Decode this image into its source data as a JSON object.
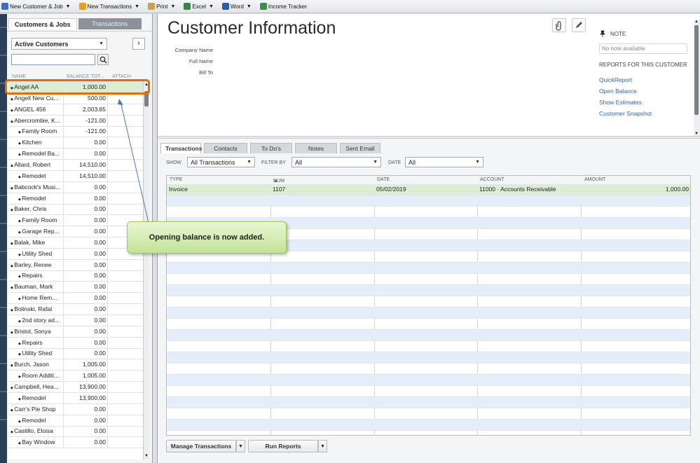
{
  "toolbar": {
    "items": [
      {
        "label": "New Customer & Job",
        "has_menu": true,
        "icon": "new-customer-icon",
        "color": "#3b6fb6"
      },
      {
        "label": "New Transactions",
        "has_menu": true,
        "icon": "new-transaction-icon",
        "color": "#e0a020"
      },
      {
        "label": "Print",
        "has_menu": true,
        "icon": "print-icon",
        "color": "#c9a24a"
      },
      {
        "label": "Excel",
        "has_menu": true,
        "icon": "excel-icon",
        "color": "#2d8a3e"
      },
      {
        "label": "Word",
        "has_menu": true,
        "icon": "word-icon",
        "color": "#2a5ca8"
      },
      {
        "label": "Income Tracker",
        "has_menu": false,
        "icon": "income-tracker-icon",
        "color": "#3c8f4a"
      }
    ]
  },
  "center": {
    "tabs": [
      {
        "label": "Customers & Jobs",
        "active": true
      },
      {
        "label": "Transactions",
        "active": false
      }
    ],
    "view_filter": "Active Customers",
    "search_value": "",
    "columns": [
      "NAME",
      "BALANCE TOT...",
      "ATTACH"
    ],
    "rows": [
      {
        "name": "Angel AA",
        "balance": "1,000.00",
        "sub": false,
        "selected": true
      },
      {
        "name": "Angell New Cu...",
        "balance": "500.00",
        "sub": false
      },
      {
        "name": "ANGEL 456",
        "balance": "2,003.65",
        "sub": false
      },
      {
        "name": "Abercrombie, K...",
        "balance": "-121.00",
        "sub": false
      },
      {
        "name": "Family Room",
        "balance": "-121.00",
        "sub": true
      },
      {
        "name": "Kitchen",
        "balance": "0.00",
        "sub": true
      },
      {
        "name": "Remodel Ba...",
        "balance": "0.00",
        "sub": true
      },
      {
        "name": "Allard, Robert",
        "balance": "14,510.00",
        "sub": false
      },
      {
        "name": "Remodel",
        "balance": "14,510.00",
        "sub": true
      },
      {
        "name": "Babcock's Musi...",
        "balance": "0.00",
        "sub": false
      },
      {
        "name": "Remodel",
        "balance": "0.00",
        "sub": true
      },
      {
        "name": "Baker, Chris",
        "balance": "0.00",
        "sub": false
      },
      {
        "name": "Family Room",
        "balance": "0.00",
        "sub": true
      },
      {
        "name": "Garage Rep...",
        "balance": "0.00",
        "sub": true
      },
      {
        "name": "Balak, Mike",
        "balance": "0.00",
        "sub": false
      },
      {
        "name": "Utility Shed",
        "balance": "0.00",
        "sub": true
      },
      {
        "name": "Barley, Renee",
        "balance": "0.00",
        "sub": false
      },
      {
        "name": "Repairs",
        "balance": "0.00",
        "sub": true
      },
      {
        "name": "Bauman, Mark",
        "balance": "0.00",
        "sub": false
      },
      {
        "name": "Home Rem...",
        "balance": "0.00",
        "sub": true
      },
      {
        "name": "Bolinski, Rafal",
        "balance": "0.00",
        "sub": false
      },
      {
        "name": "2nd story ad...",
        "balance": "0.00",
        "sub": true
      },
      {
        "name": "Bristol, Sonya",
        "balance": "0.00",
        "sub": false
      },
      {
        "name": "Repairs",
        "balance": "0.00",
        "sub": true
      },
      {
        "name": "Utility Shed",
        "balance": "0.00",
        "sub": true
      },
      {
        "name": "Burch, Jason",
        "balance": "1,005.00",
        "sub": false
      },
      {
        "name": "Room Additi...",
        "balance": "1,005.00",
        "sub": true
      },
      {
        "name": "Campbell, Hea...",
        "balance": "13,900.00",
        "sub": false
      },
      {
        "name": "Remodel",
        "balance": "13,900.00",
        "sub": true
      },
      {
        "name": "Carr's Pie Shop",
        "balance": "0.00",
        "sub": false
      },
      {
        "name": "Remodel",
        "balance": "0.00",
        "sub": true
      },
      {
        "name": "Castillo, Eloisa",
        "balance": "0.00",
        "sub": false
      },
      {
        "name": "Bay Window",
        "balance": "0.00",
        "sub": true
      }
    ]
  },
  "info": {
    "title": "Customer Information",
    "fields": [
      "Company Name",
      "Full Name",
      "Bill To"
    ],
    "note_label": "NOTE",
    "note_text": "No note available",
    "reports_label": "REPORTS FOR THIS CUSTOMER",
    "reports": [
      "QuickReport",
      "Open Balance",
      "Show Estimates",
      "Customer Snapshot"
    ]
  },
  "lower": {
    "tabs": [
      {
        "label": "Transactions",
        "active": true
      },
      {
        "label": "Contacts",
        "active": false
      },
      {
        "label": "To Do's",
        "active": false
      },
      {
        "label": "Notes",
        "active": false
      },
      {
        "label": "Sent Email",
        "active": false
      }
    ],
    "show_label": "SHOW",
    "show_value": "All Transactions",
    "filter_label": "FILTER BY",
    "filter_value": "All",
    "date_label": "DATE",
    "date_value": "All",
    "columns": [
      "TYPE",
      "NUM",
      "DATE",
      "ACCOUNT",
      "AMOUNT"
    ],
    "rows": [
      {
        "type": "Invoice",
        "num": "1107",
        "date": "05/02/2019",
        "account": "11000 · Accounts Receivable",
        "amount": "1,000.00"
      }
    ],
    "buttons": [
      "Manage Transactions",
      "Run Reports"
    ]
  },
  "callout": {
    "text": "Opening balance is now added.",
    "color": "#c3e397",
    "highlight_color": "#e46c0a"
  }
}
